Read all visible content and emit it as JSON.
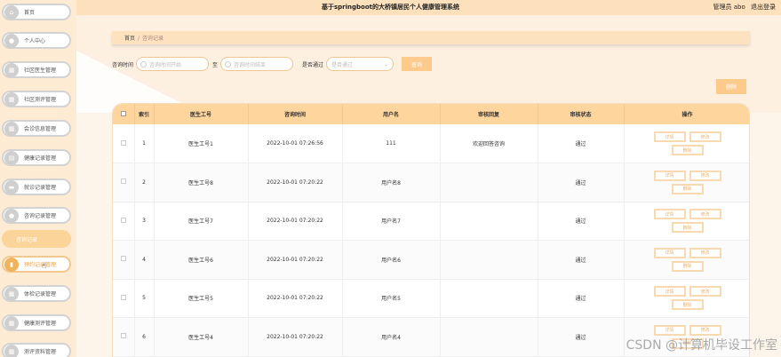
{
  "header": {
    "title": "基于springboot的大桥镇居民个人健康管理系统",
    "role": "管理员 abo",
    "logout": "退出登录"
  },
  "sidebar": {
    "items": [
      {
        "label": "首页",
        "icon": "home-icon",
        "glyph": "⌂"
      },
      {
        "label": "个人中心",
        "icon": "user-icon",
        "glyph": "●"
      },
      {
        "label": "社区医生管理",
        "icon": "doctor-icon",
        "glyph": "▦"
      },
      {
        "label": "社区测评管理",
        "icon": "grid-icon",
        "glyph": "▦"
      },
      {
        "label": "会诊信息管理",
        "icon": "grid-icon",
        "glyph": "▦"
      },
      {
        "label": "健康记录管理",
        "icon": "list-icon",
        "glyph": "▤"
      },
      {
        "label": "就诊记录管理",
        "icon": "chat-icon",
        "glyph": "▬"
      },
      {
        "label": "咨询记录管理",
        "icon": "user-group-icon",
        "glyph": "●"
      }
    ],
    "sub_item": "咨询记录",
    "items_after": [
      {
        "label": "预约记录管理",
        "icon": "chart-icon",
        "glyph": "▮",
        "active": true
      },
      {
        "label": "体检记录管理",
        "icon": "grid-icon",
        "glyph": "▦"
      },
      {
        "label": "健康测评管理",
        "icon": "grid-icon",
        "glyph": "▦"
      },
      {
        "label": "测评资料管理",
        "icon": "grid-icon",
        "glyph": "▦"
      }
    ]
  },
  "breadcrumb": {
    "home": "首页",
    "separator": "/",
    "current": "咨询记录"
  },
  "filters": {
    "time_label": "咨询时间",
    "start_placeholder": "咨询时间开始",
    "to_label": "至",
    "end_placeholder": "咨询时间结束",
    "review_label": "是否通过",
    "review_placeholder": "是否通过",
    "search_button": "查询"
  },
  "delete_button": "删除",
  "table": {
    "columns": [
      "",
      "索引",
      "医生工号",
      "咨询时间",
      "用户名",
      "审核回复",
      "审核状态",
      "操作"
    ],
    "rows": [
      {
        "index": "1",
        "doctor": "医生工号1",
        "time": "2022-10-01 07:26:56",
        "user": "111",
        "reply": "欢迎回答咨询",
        "status": "通过"
      },
      {
        "index": "2",
        "doctor": "医生工号8",
        "time": "2022-10-01 07:20:22",
        "user": "用户名8",
        "reply": "",
        "status": "通过"
      },
      {
        "index": "3",
        "doctor": "医生工号7",
        "time": "2022-10-01 07:20:22",
        "user": "用户名7",
        "reply": "",
        "status": "通过"
      },
      {
        "index": "4",
        "doctor": "医生工号6",
        "time": "2022-10-01 07:20:22",
        "user": "用户名6",
        "reply": "",
        "status": "通过"
      },
      {
        "index": "5",
        "doctor": "医生工号5",
        "time": "2022-10-01 07:20:22",
        "user": "用户名5",
        "reply": "",
        "status": "通过"
      },
      {
        "index": "6",
        "doctor": "医生工号4",
        "time": "2022-10-01 07:20:22",
        "user": "用户名4",
        "reply": "",
        "status": "通过"
      }
    ],
    "actions": {
      "detail": "详情",
      "edit": "修改",
      "delete": "删除"
    }
  },
  "watermark": "CSDN @计算机毕设工作室",
  "colors": {
    "topbar": "#fde1bd",
    "sidebar": "#fdebd3",
    "accent": "#fcca8a",
    "table_header": "#fed59c"
  }
}
